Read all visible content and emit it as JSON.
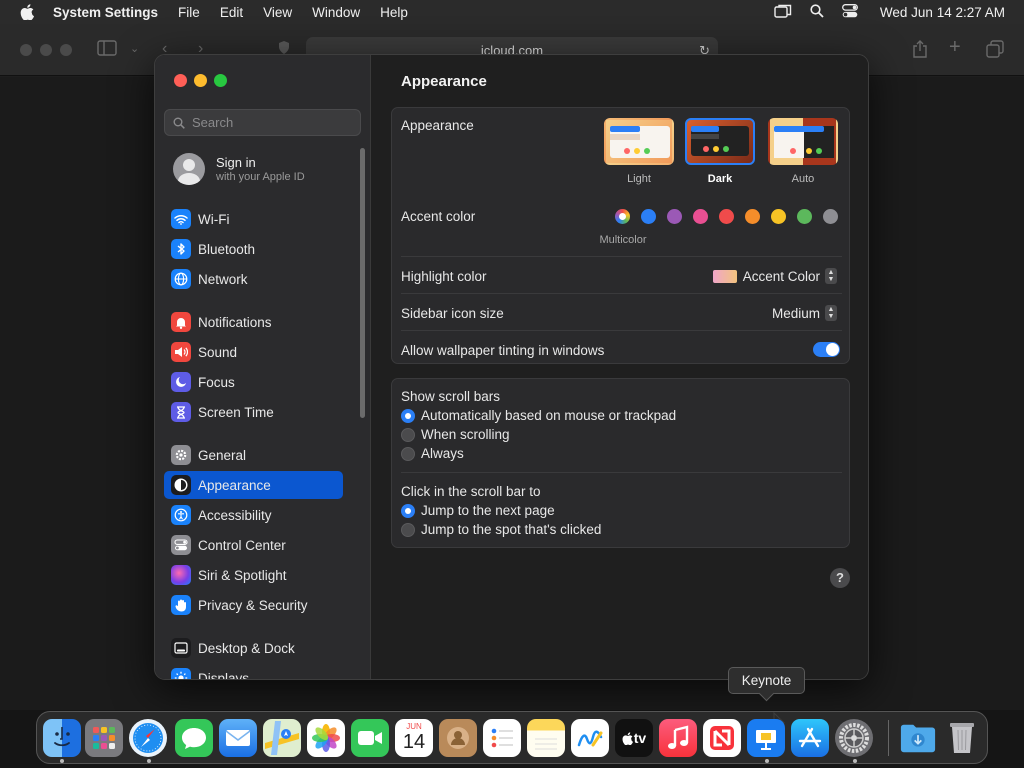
{
  "menubar": {
    "app_name": "System Settings",
    "menus": [
      "File",
      "Edit",
      "View",
      "Window",
      "Help"
    ],
    "clock": "Wed Jun 14  2:27 AM"
  },
  "safari": {
    "url": "icloud.com"
  },
  "sidebar": {
    "search_placeholder": "Search",
    "signin_title": "Sign in",
    "signin_subtitle": "with your Apple ID",
    "items": [
      {
        "label": "Wi-Fi",
        "icon": "wifi-icon",
        "color": "#1a82fb"
      },
      {
        "label": "Bluetooth",
        "icon": "bluetooth-icon",
        "color": "#1a82fb"
      },
      {
        "label": "Network",
        "icon": "globe-icon",
        "color": "#1a82fb"
      },
      {
        "label": "Notifications",
        "icon": "bell-icon",
        "color": "#f0473e"
      },
      {
        "label": "Sound",
        "icon": "speaker-icon",
        "color": "#f0473e"
      },
      {
        "label": "Focus",
        "icon": "moon-icon",
        "color": "#5e5ce6"
      },
      {
        "label": "Screen Time",
        "icon": "hourglass-icon",
        "color": "#5e5ce6"
      },
      {
        "label": "General",
        "icon": "gear-icon",
        "color": "#8e8e93"
      },
      {
        "label": "Appearance",
        "icon": "appearance-icon",
        "color": "#1c1c1e"
      },
      {
        "label": "Accessibility",
        "icon": "accessibility-icon",
        "color": "#1a82fb"
      },
      {
        "label": "Control Center",
        "icon": "control-center-icon",
        "color": "#8e8e93"
      },
      {
        "label": "Siri & Spotlight",
        "icon": "siri-icon",
        "color": "#7a3ee6"
      },
      {
        "label": "Privacy & Security",
        "icon": "hand-icon",
        "color": "#1a82fb"
      },
      {
        "label": "Desktop & Dock",
        "icon": "dock-icon",
        "color": "#1c1c1e"
      },
      {
        "label": "Displays",
        "icon": "sun-icon",
        "color": "#1a82fb"
      }
    ],
    "selected": "Appearance"
  },
  "main": {
    "title": "Appearance",
    "appearance_label": "Appearance",
    "themes": [
      "Light",
      "Dark",
      "Auto"
    ],
    "selected_theme": "Dark",
    "accent_label": "Accent color",
    "accent_colors": [
      "multicolor",
      "#2b7ff6",
      "#9b59b6",
      "#e94f92",
      "#f04b4b",
      "#f58d2a",
      "#f7c325",
      "#5cb85c",
      "#8e8e93"
    ],
    "accent_selected_label": "Multicolor",
    "highlight_label": "Highlight color",
    "highlight_value": "Accent Color",
    "sidebar_icon_label": "Sidebar icon size",
    "sidebar_icon_value": "Medium",
    "tinting_label": "Allow wallpaper tinting in windows",
    "tinting_on": true,
    "scrollbars_title": "Show scroll bars",
    "scrollbars_options": [
      "Automatically based on mouse or trackpad",
      "When scrolling",
      "Always"
    ],
    "scrollbars_selected": 0,
    "click_title": "Click in the scroll bar to",
    "click_options": [
      "Jump to the next page",
      "Jump to the spot that's clicked"
    ],
    "click_selected": 0,
    "help": "?"
  },
  "dock": {
    "tooltip": "Keynote",
    "calendar_month": "JUN",
    "calendar_day": "14",
    "tv_label": "tv"
  }
}
